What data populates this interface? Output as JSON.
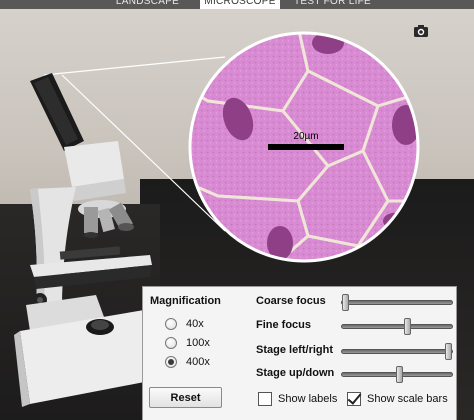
{
  "tabs": [
    {
      "label": "LANDSCAPE",
      "active": false
    },
    {
      "label": "MICROSCOPE",
      "active": true
    },
    {
      "label": "TEST FOR LIFE",
      "active": false
    }
  ],
  "toolbar": {
    "camera_icon": "camera-icon"
  },
  "view": {
    "scale_bar_label": "20µm"
  },
  "panel": {
    "magnification_heading": "Magnification",
    "magnification_options": [
      "40x",
      "100x",
      "400x"
    ],
    "selected_magnification": "400x",
    "sliders": [
      {
        "label": "Coarse focus",
        "value": 0.0
      },
      {
        "label": "Fine focus",
        "value": 0.6
      },
      {
        "label": "Stage left/right",
        "value": 1.0
      },
      {
        "label": "Stage up/down",
        "value": 0.52
      }
    ],
    "reset_label": "Reset",
    "show_labels": {
      "label": "Show labels",
      "checked": false
    },
    "show_scale_bars": {
      "label": "Show scale bars",
      "checked": true
    }
  },
  "colors": {
    "cell_fill": "#d58bd0",
    "nucleus": "#8e3f86",
    "membrane": "#e8dccc"
  }
}
